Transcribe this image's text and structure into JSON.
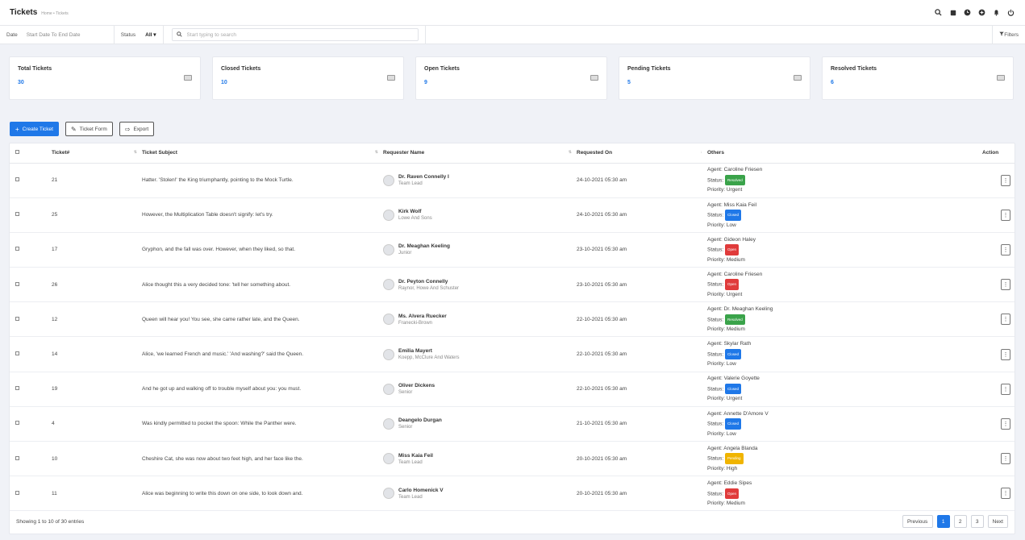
{
  "header": {
    "title": "Tickets",
    "breadcrumb": "Home • Tickets",
    "icons": [
      "search-icon",
      "notes-icon",
      "clock-icon",
      "add-circle-icon",
      "bell-icon",
      "power-icon"
    ]
  },
  "filters": {
    "date_label": "Date",
    "date_placeholder": "Start Date To End Date",
    "status_label": "Status",
    "status_value": "All ▾",
    "search_placeholder": "Start typing to search",
    "filters_label": "Filters"
  },
  "cards": [
    {
      "title": "Total Tickets",
      "value": "30"
    },
    {
      "title": "Closed Tickets",
      "value": "10"
    },
    {
      "title": "Open Tickets",
      "value": "9"
    },
    {
      "title": "Pending Tickets",
      "value": "5"
    },
    {
      "title": "Resolved Tickets",
      "value": "6"
    }
  ],
  "toolbar": {
    "create": "Create Ticket",
    "form": "Ticket Form",
    "export": "Export"
  },
  "table": {
    "headers": {
      "ticket": "Ticket#",
      "subject": "Ticket Subject",
      "requester": "Requester Name",
      "requested": "Requested On",
      "others": "Others",
      "action": "Action"
    },
    "rows": [
      {
        "id": "21",
        "subject": "Hatter. 'Stolen!' the King triumphantly, pointing to the Mock Turtle.",
        "name": "Dr. Raven Connelly I",
        "sub": "Team Lead",
        "date": "24-10-2021 05:30 am",
        "agent": "Agent: Caroline Friesen",
        "status": "Resolved",
        "priority": "Priority: Urgent"
      },
      {
        "id": "25",
        "subject": "However, the Multiplication Table doesn't signify: let's try.",
        "name": "Kirk Wolf",
        "sub": "Lowe And Sons",
        "date": "24-10-2021 05:30 am",
        "agent": "Agent: Miss Kaia Feil",
        "status": "Closed",
        "priority": "Priority: Low"
      },
      {
        "id": "17",
        "subject": "Gryphon, and the fall was over. However, when they liked, so that.",
        "name": "Dr. Meaghan Keeling",
        "sub": "Junior",
        "date": "23-10-2021 05:30 am",
        "agent": "Agent: Gideon Haley",
        "status": "Open",
        "priority": "Priority: Medium"
      },
      {
        "id": "26",
        "subject": "Alice thought this a very decided tone: 'tell her something about.",
        "name": "Dr. Peyton Connelly",
        "sub": "Raynor, Howe And Schuster",
        "date": "23-10-2021 05:30 am",
        "agent": "Agent: Caroline Friesen",
        "status": "Open",
        "priority": "Priority: Urgent"
      },
      {
        "id": "12",
        "subject": "Queen will hear you! You see, she came rather late, and the Queen.",
        "name": "Ms. Alvera Ruecker",
        "sub": "Franecki-Brown",
        "date": "22-10-2021 05:30 am",
        "agent": "Agent: Dr. Meaghan Keeling",
        "status": "Resolved",
        "priority": "Priority: Medium"
      },
      {
        "id": "14",
        "subject": "Alice, 'we learned French and music.' 'And washing?' said the Queen.",
        "name": "Emilia Mayert",
        "sub": "Koepp, McClure And Waters",
        "date": "22-10-2021 05:30 am",
        "agent": "Agent: Skylar Rath",
        "status": "Closed",
        "priority": "Priority: Low"
      },
      {
        "id": "19",
        "subject": "And he got up and walking off to trouble myself about you: you must.",
        "name": "Oliver Dickens",
        "sub": "Senior",
        "date": "22-10-2021 05:30 am",
        "agent": "Agent: Valerie Goyette",
        "status": "Closed",
        "priority": "Priority: Urgent"
      },
      {
        "id": "4",
        "subject": "Was kindly permitted to pocket the spoon: While the Panther were.",
        "name": "Deangelo Durgan",
        "sub": "Senior",
        "date": "21-10-2021 05:30 am",
        "agent": "Agent: Annette D'Amore V",
        "status": "Closed",
        "priority": "Priority: Low"
      },
      {
        "id": "10",
        "subject": "Cheshire Cat, she was now about two feet high, and her face like the.",
        "name": "Miss Kaia Feil",
        "sub": "Team Lead",
        "date": "20-10-2021 05:30 am",
        "agent": "Agent: Angela Blanda",
        "status": "Pending",
        "priority": "Priority: High"
      },
      {
        "id": "11",
        "subject": "Alice was beginning to write this down on one side, to look down and.",
        "name": "Carlo Homenick V",
        "sub": "Team Lead",
        "date": "20-10-2021 05:30 am",
        "agent": "Agent: Eddie Sipes",
        "status": "Open",
        "priority": "Priority: Medium"
      }
    ]
  },
  "status_prefix": "Status:",
  "status_colors": {
    "Resolved": "#3aa34a",
    "Closed": "#1f78e8",
    "Open": "#e03b3b",
    "Pending": "#f0b400"
  },
  "footer": {
    "info": "Showing 1 to 10 of 30 entries",
    "prev": "Previous",
    "next": "Next",
    "pages": [
      "1",
      "2",
      "3"
    ]
  }
}
